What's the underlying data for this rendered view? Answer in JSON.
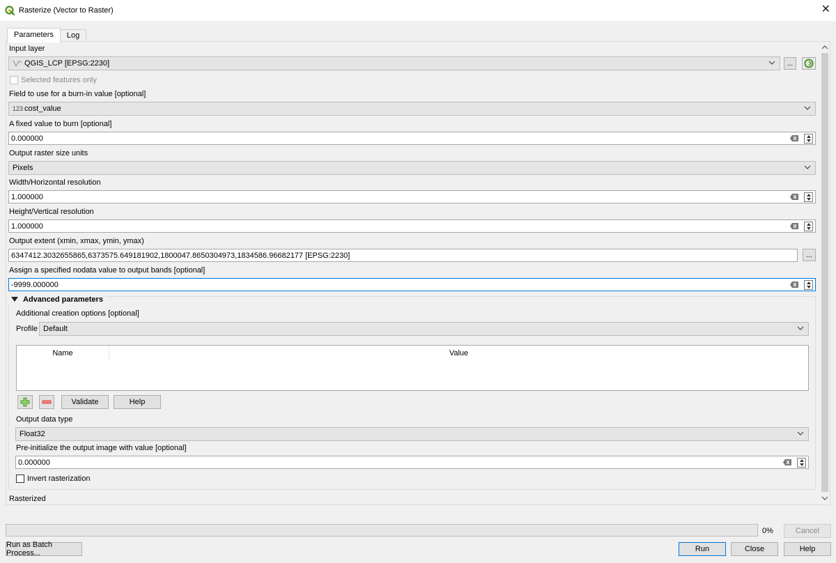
{
  "window": {
    "title": "Rasterize (Vector to Raster)"
  },
  "tabs": [
    {
      "label": "Parameters"
    },
    {
      "label": "Log"
    }
  ],
  "input_layer": {
    "label": "Input layer",
    "value": "QGIS_LCP [EPSG:2230]",
    "browse_label": "...",
    "selected_only_label": "Selected features only"
  },
  "burn_field": {
    "label": "Field to use for a burn-in value [optional]",
    "type_glyph": "123",
    "value": "cost_value"
  },
  "fixed_burn": {
    "label": "A fixed value to burn [optional]",
    "value": "0.000000"
  },
  "size_units": {
    "label": "Output raster size units",
    "value": "Pixels"
  },
  "width_res": {
    "label": "Width/Horizontal resolution",
    "value": "1.000000"
  },
  "height_res": {
    "label": "Height/Vertical resolution",
    "value": "1.000000"
  },
  "extent": {
    "label": "Output extent (xmin, xmax, ymin, ymax)",
    "value": "6347412.3032655865,6373575.649181902,1800047.8650304973,1834586.96682177 [EPSG:2230]",
    "browse_label": "..."
  },
  "nodata": {
    "label": "Assign a specified nodata value to output bands [optional]",
    "value": "-9999.000000"
  },
  "advanced": {
    "header": "Advanced parameters",
    "creation_label": "Additional creation options [optional]",
    "profile_label": "Profile",
    "profile_value": "Default",
    "table": {
      "col_name": "Name",
      "col_value": "Value"
    },
    "validate_label": "Validate",
    "help_label": "Help",
    "data_type_label": "Output data type",
    "data_type_value": "Float32",
    "preinit_label": "Pre-initialize the output image with value [optional]",
    "preinit_value": "0.000000",
    "invert_label": "Invert rasterization"
  },
  "rasterized_label": "Rasterized",
  "progress": {
    "percent_text": "0%",
    "fraction": 0.0
  },
  "buttons": {
    "cancel": "Cancel",
    "batch": "Run as Batch Process...",
    "run": "Run",
    "close": "Close",
    "help": "Help"
  },
  "colors": {
    "accent": "#0078d7",
    "qgis_green": "#589632",
    "add_green": "#4c9a2a",
    "remove_red": "#d9534f"
  }
}
